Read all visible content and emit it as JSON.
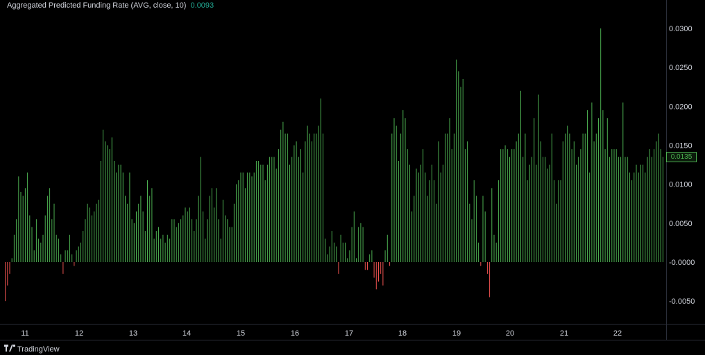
{
  "legend": {
    "title": "Aggregated Predicted Funding Rate (AVG, close, 10)",
    "value": "0.0093"
  },
  "brand": {
    "name": "TradingView",
    "logo_icon": "tradingview-logo-icon"
  },
  "colors": {
    "positive": "#4caf50",
    "negative": "#ef5350",
    "background": "#000000",
    "text": "#d1d4dc"
  },
  "chart_data": {
    "type": "bar",
    "title": "Aggregated Predicted Funding Rate (AVG, close, 10)",
    "ylim": [
      -0.0082,
      0.0335
    ],
    "y_ticks": [
      "0.0300",
      "0.0250",
      "0.0200",
      "0.0150",
      "0.0100",
      "0.0050",
      "-0.0000",
      "-0.0050"
    ],
    "x_ticks": [
      "11",
      "12",
      "13",
      "14",
      "15",
      "16",
      "17",
      "18",
      "19",
      "20",
      "21",
      "22"
    ],
    "last_value_label": "0.0135",
    "values": [
      -0.005,
      -0.003,
      -0.0015,
      0.0005,
      0.0035,
      0.0055,
      0.011,
      0.009,
      0.0085,
      0.0095,
      0.0115,
      0.006,
      0.0045,
      0.0015,
      0.0055,
      0.003,
      0.0025,
      0.0035,
      0.006,
      0.0085,
      0.0095,
      0.0055,
      0.0075,
      0.0035,
      0.003,
      0.001,
      -0.0015,
      0.0015,
      0.0015,
      0.0035,
      0.001,
      -0.0005,
      0.0015,
      0.002,
      0.0025,
      0.004,
      0.0055,
      0.0075,
      0.007,
      0.006,
      0.0065,
      0.0075,
      0.008,
      0.013,
      0.017,
      0.0155,
      0.015,
      0.0145,
      0.016,
      0.013,
      0.0115,
      0.0125,
      0.0125,
      0.0115,
      0.0085,
      0.0075,
      0.0115,
      0.0055,
      0.005,
      0.0065,
      0.0075,
      0.0085,
      0.0065,
      0.004,
      0.0105,
      0.0085,
      0.0095,
      0.003,
      0.004,
      0.0045,
      0.003,
      0.0035,
      0.0025,
      0.0035,
      0.003,
      0.0055,
      0.0055,
      0.0045,
      0.005,
      0.0055,
      0.006,
      0.007,
      0.0065,
      0.007,
      0.0055,
      0.004,
      0.0055,
      0.0085,
      0.0135,
      0.0065,
      0.003,
      0.0055,
      0.0085,
      0.0095,
      0.007,
      0.0095,
      0.0055,
      0.003,
      0.008,
      0.006,
      0.0055,
      0.0045,
      0.0045,
      0.0075,
      0.01,
      0.0105,
      0.0115,
      0.0115,
      0.0095,
      0.0115,
      0.0115,
      0.011,
      0.0115,
      0.013,
      0.013,
      0.0125,
      0.0125,
      0.0105,
      0.0125,
      0.0135,
      0.0135,
      0.0135,
      0.012,
      0.0145,
      0.017,
      0.018,
      0.0165,
      0.0165,
      0.0125,
      0.0135,
      0.015,
      0.0155,
      0.0135,
      0.0145,
      0.0115,
      0.0155,
      0.0175,
      0.0165,
      0.0155,
      0.0165,
      0.0165,
      0.0175,
      0.021,
      0.0165,
      0.003,
      0.001,
      0.002,
      0.004,
      0.0025,
      0.002,
      -0.0015,
      0.0035,
      0.0025,
      0.0025,
      0.0005,
      0.0015,
      0.0045,
      0.0065,
      0.0005,
      0.0045,
      0.005,
      0.0045,
      -0.001,
      -0.001,
      0.001,
      0.0015,
      -0.002,
      -0.0035,
      -0.0025,
      -0.0015,
      -0.003,
      0.0015,
      0.0035,
      -0.0005,
      0.0165,
      0.0185,
      0.0175,
      0.013,
      0.0165,
      0.0195,
      0.0185,
      0.0145,
      0.0125,
      0.0065,
      0.0085,
      0.012,
      0.0115,
      0.0125,
      0.0145,
      0.0115,
      0.0085,
      0.0105,
      0.0125,
      0.0105,
      0.0075,
      0.0155,
      0.0115,
      0.0125,
      0.0165,
      0.0165,
      0.0185,
      0.0145,
      0.0165,
      0.026,
      0.0245,
      0.0225,
      0.0235,
      0.0145,
      0.0155,
      0.0075,
      0.0055,
      0.0105,
      0.0085,
      0.0025,
      -0.0005,
      0.0085,
      0.0065,
      -0.0015,
      -0.0045,
      0.0095,
      0.0035,
      0.0025,
      0.0105,
      0.0145,
      0.0145,
      0.015,
      0.0145,
      0.0135,
      0.0145,
      0.0145,
      0.0155,
      0.0165,
      0.022,
      0.0135,
      0.0165,
      0.0105,
      0.0125,
      0.0135,
      0.0185,
      0.0125,
      0.0215,
      0.0155,
      0.0135,
      0.0135,
      0.012,
      0.0125,
      0.0165,
      0.0105,
      0.0075,
      0.0105,
      0.0105,
      0.0155,
      0.0165,
      0.0175,
      0.0165,
      0.0145,
      0.0155,
      0.0125,
      0.0135,
      0.0145,
      0.0165,
      0.0165,
      0.0195,
      0.0115,
      0.0205,
      0.0155,
      0.0165,
      0.0185,
      0.03,
      0.0195,
      0.0145,
      0.0185,
      0.0135,
      0.0145,
      0.0145,
      0.0145,
      0.0135,
      0.0135,
      0.0205,
      0.0135,
      0.0135,
      0.0115,
      0.0105,
      0.0115,
      0.0125,
      0.0115,
      0.0125,
      0.0125,
      0.0115,
      0.0135,
      0.0145,
      0.0135,
      0.0145,
      0.0155,
      0.0165,
      0.0145,
      0.0135
    ]
  }
}
